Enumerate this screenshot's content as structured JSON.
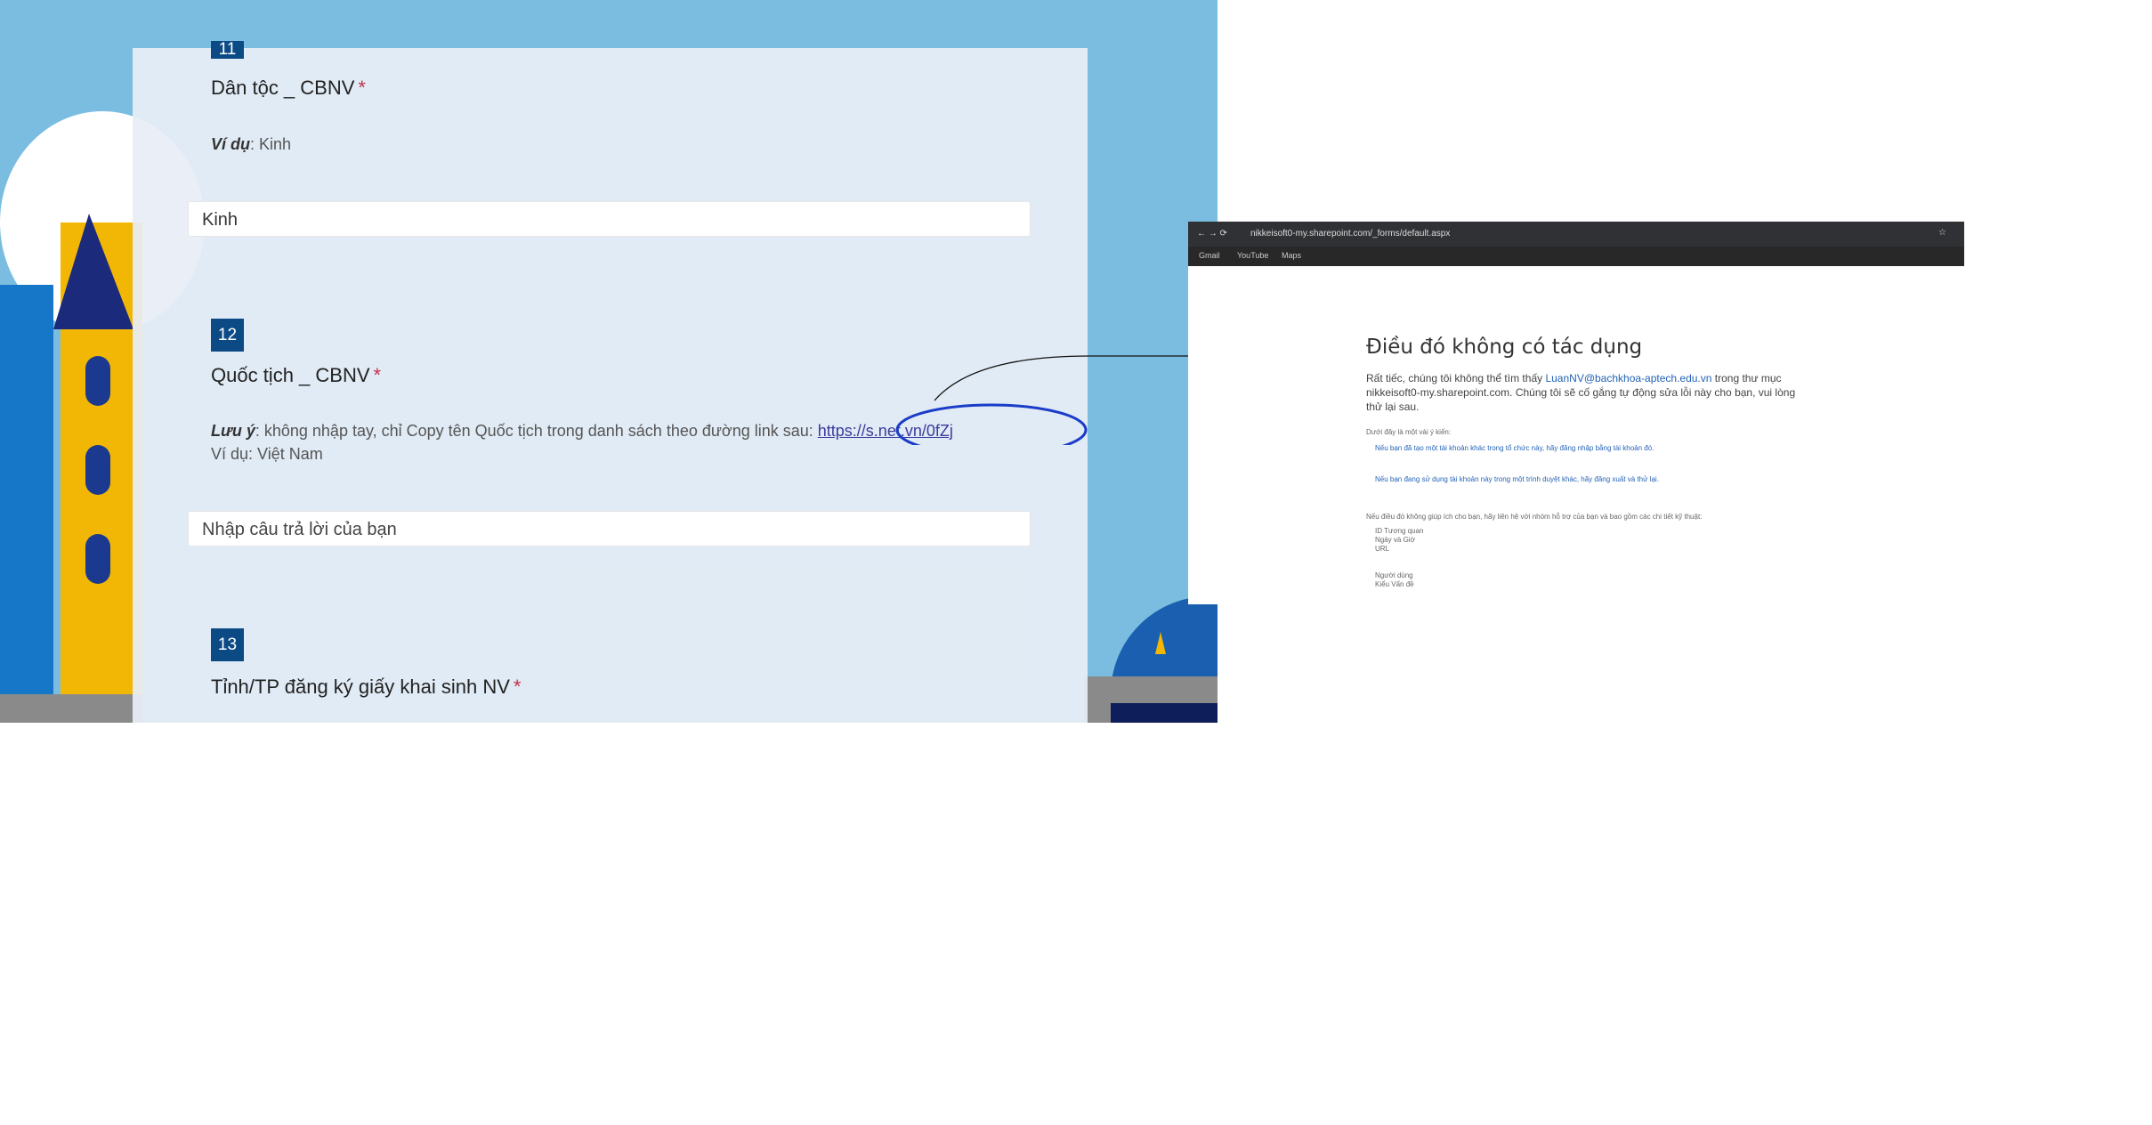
{
  "form": {
    "q11": {
      "number": "11",
      "title": "Dân tộc _ CBNV",
      "required_mark": "*",
      "hint_label": "Ví dụ",
      "hint_text": ": Kinh",
      "answer": "Kinh"
    },
    "q12": {
      "number": "12",
      "title": "Quốc tịch _ CBNV",
      "required_mark": "*",
      "note_label": "Lưu ý",
      "note_text": ": không nhập tay, chỉ Copy tên Quốc tịch trong danh sách theo đường link sau: ",
      "link": "https://s.net.vn/0fZj",
      "example": "Ví dụ: Việt Nam",
      "placeholder": "Nhập câu trả lời của bạn"
    },
    "q13": {
      "number": "13",
      "title": "Tỉnh/TP đăng ký giấy khai sinh NV",
      "required_mark": "*"
    }
  },
  "browser": {
    "url": "nikkeisoft0-my.sharepoint.com/_forms/default.aspx",
    "bookmarks": [
      "Gmail",
      "YouTube",
      "Maps"
    ]
  },
  "error_page": {
    "title": "Điều đó không có tác dụng",
    "message_pre": "Rất tiếc, chúng tôi không thể tìm thấy ",
    "email": "LuanNV@bachkhoa-aptech.edu.vn",
    "message_post": " trong thư mục nikkeisoft0-my.sharepoint.com. Chúng tôi sẽ cố gắng tự động sửa lỗi này cho bạn, vui lòng thử lại sau.",
    "options_heading": "Dưới đây là một vài ý kiến:",
    "option1": "Nếu bạn đã tạo một tài khoản khác trong tổ chức này, hãy đăng nhập bằng tài khoản đó.",
    "option2": "Nếu bạn đang sử dụng tài khoản này trong một trình duyệt khác, hãy đăng xuất và thử lại.",
    "contact": "Nếu điều đó không giúp ích cho bạn, hãy liên hệ với nhóm hỗ trợ của bạn và bao gồm các chi tiết kỹ thuật:",
    "details": [
      "ID Tương quan",
      "Ngày và Giờ",
      "URL",
      "Người dùng",
      "Kiểu Vấn đề"
    ]
  },
  "colors": {
    "qnum_bg": "#0c4a86",
    "annotation": "#1a3cc8",
    "sky": "#7bbde0"
  }
}
